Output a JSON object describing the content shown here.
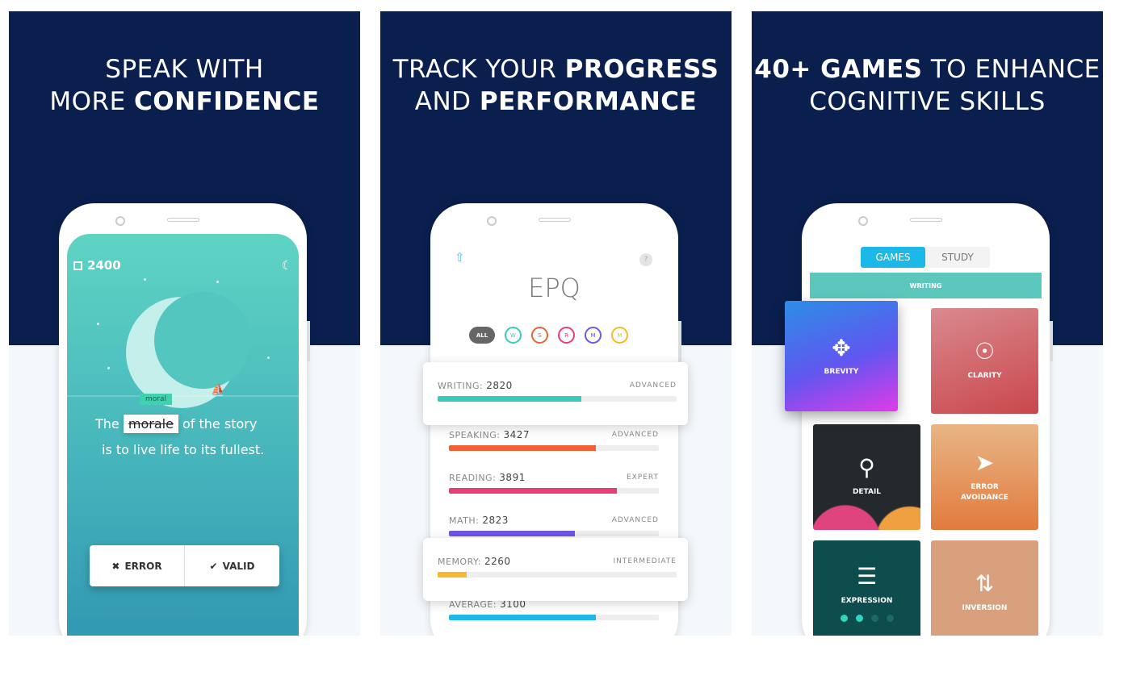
{
  "panels": [
    {
      "headline_line1": "SPEAK WITH",
      "headline_line2_plain": "MORE ",
      "headline_line2_bold": "CONFIDENCE"
    },
    {
      "headline_line1_plain": "TRACK YOUR ",
      "headline_line1_bold": "PROGRESS",
      "headline_line2_plain": "AND ",
      "headline_line2_bold": "PERFORMANCE"
    },
    {
      "headline_line1_bold": "40+ GAMES",
      "headline_line1_plain": " TO ENHANCE",
      "headline_line2": "COGNITIVE SKILLS"
    }
  ],
  "speak_screen": {
    "score": "2400",
    "correction": "moral",
    "struck_word": "morale",
    "sentence_start": "The",
    "sentence_end": "of the story",
    "sentence_line2": "is to live life to its fullest.",
    "error_label": "ERROR",
    "valid_label": "VALID",
    "icons": [
      "score-icon",
      "moon-icon",
      "close-icon",
      "check-icon"
    ]
  },
  "progress_screen": {
    "title": "EPQ",
    "filters": [
      {
        "label": "ALL",
        "color": "#666666"
      },
      {
        "label": "W",
        "color": "#3cc9bb"
      },
      {
        "label": "S",
        "color": "#f06034"
      },
      {
        "label": "R",
        "color": "#e83e77"
      },
      {
        "label": "M",
        "color": "#7055e6"
      },
      {
        "label": "M",
        "color": "#f5b82e"
      }
    ],
    "stats": [
      {
        "name": "WRITING:",
        "score": "2820",
        "level": "ADVANCED",
        "progress": 0.6,
        "color": "#3cc9bb"
      },
      {
        "name": "SPEAKING:",
        "score": "3427",
        "level": "ADVANCED",
        "progress": 0.7,
        "color": "#f06034"
      },
      {
        "name": "READING:",
        "score": "3891",
        "level": "EXPERT",
        "progress": 0.8,
        "color": "#e83e77"
      },
      {
        "name": "MATH:",
        "score": "2823",
        "level": "ADVANCED",
        "progress": 0.6,
        "color": "#7055e6"
      },
      {
        "name": "MEMORY:",
        "score": "2260",
        "level": "INTERMEDIATE",
        "progress": 0.12,
        "color": "#f5b82e"
      },
      {
        "name": "AVERAGE:",
        "score": "3100",
        "level": "",
        "progress": 0.7,
        "color": "#1cb8e8"
      }
    ]
  },
  "games_screen": {
    "tabs": [
      {
        "label": "GAMES",
        "active": true
      },
      {
        "label": "STUDY",
        "active": false
      }
    ],
    "category": "WRITING",
    "games": [
      {
        "label": "BREVITY",
        "icon": "arrows-in-icon"
      },
      {
        "label": "CLARITY",
        "icon": "focus-icon"
      },
      {
        "label": "DETAIL",
        "icon": "search-icon"
      },
      {
        "label": "ERROR AVOIDANCE",
        "icon": "signpost-icon"
      },
      {
        "label": "EXPRESSION",
        "icon": "text-lines-icon"
      },
      {
        "label": "INVERSION",
        "icon": "swap-arrows-icon"
      }
    ],
    "page_dots": 4,
    "active_dots": 2
  }
}
